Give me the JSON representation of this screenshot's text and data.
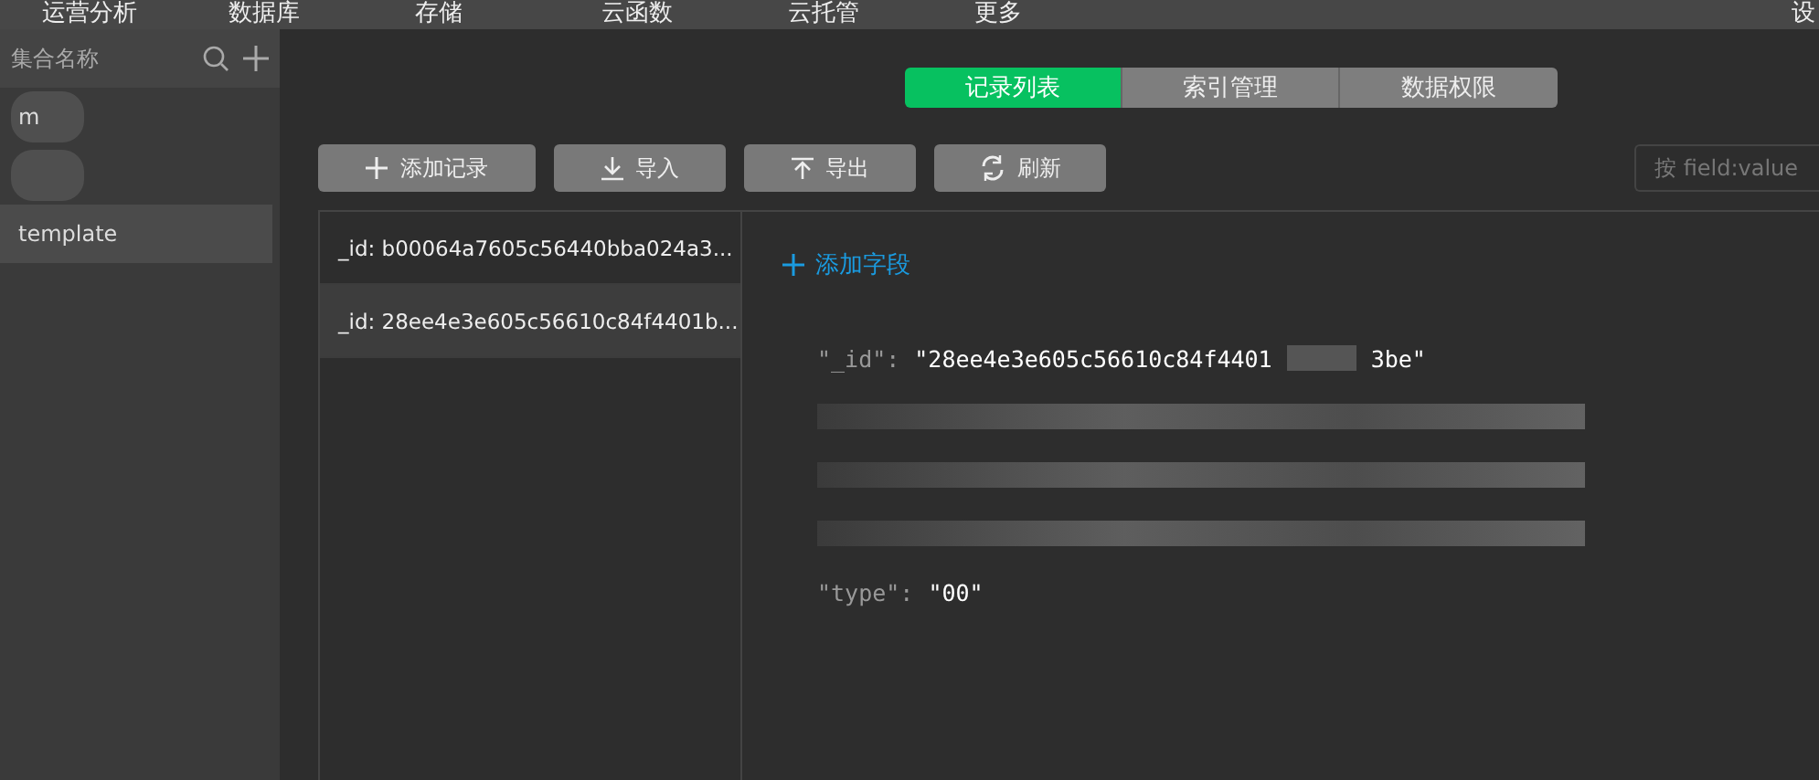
{
  "top_nav": {
    "items": [
      {
        "label": "运营分析"
      },
      {
        "label": "数据库"
      },
      {
        "label": "存储"
      },
      {
        "label": "云函数"
      },
      {
        "label": "云托管"
      },
      {
        "label": "更多"
      }
    ],
    "settings": "设"
  },
  "sidebar": {
    "title": "集合名称",
    "items": [
      {
        "kind": "blurred",
        "label": "m",
        "selected": false
      },
      {
        "kind": "blurred",
        "selected": false
      },
      {
        "kind": "plain",
        "label": "template",
        "selected": true
      }
    ]
  },
  "tabs": [
    {
      "label": "记录列表",
      "selected": true
    },
    {
      "label": "索引管理",
      "selected": false
    },
    {
      "label": "数据权限",
      "selected": false
    }
  ],
  "toolbar": [
    {
      "label": "添加记录"
    },
    {
      "label": "导入"
    },
    {
      "label": "导出"
    },
    {
      "label": "刷新"
    }
  ],
  "search": {
    "placeholder": "按 field:value"
  },
  "records": [
    {
      "label": "_id: b00064a7605c56440bba024a3...",
      "selected": false
    },
    {
      "label": "_id: 28ee4e3e605c56610c84f4401b...",
      "selected": true
    }
  ],
  "detail": {
    "add_field": "添加字段",
    "fields": [
      {
        "kind": "pair",
        "key": "\"_id\":",
        "value": "\"28ee4e3e605c56610c84f4401",
        "value_tail": "3be\""
      },
      {
        "kind": "blurred"
      },
      {
        "kind": "blurred"
      },
      {
        "kind": "blurred"
      },
      {
        "kind": "pair",
        "key": "\"type\":",
        "value": "\"00\""
      }
    ]
  }
}
